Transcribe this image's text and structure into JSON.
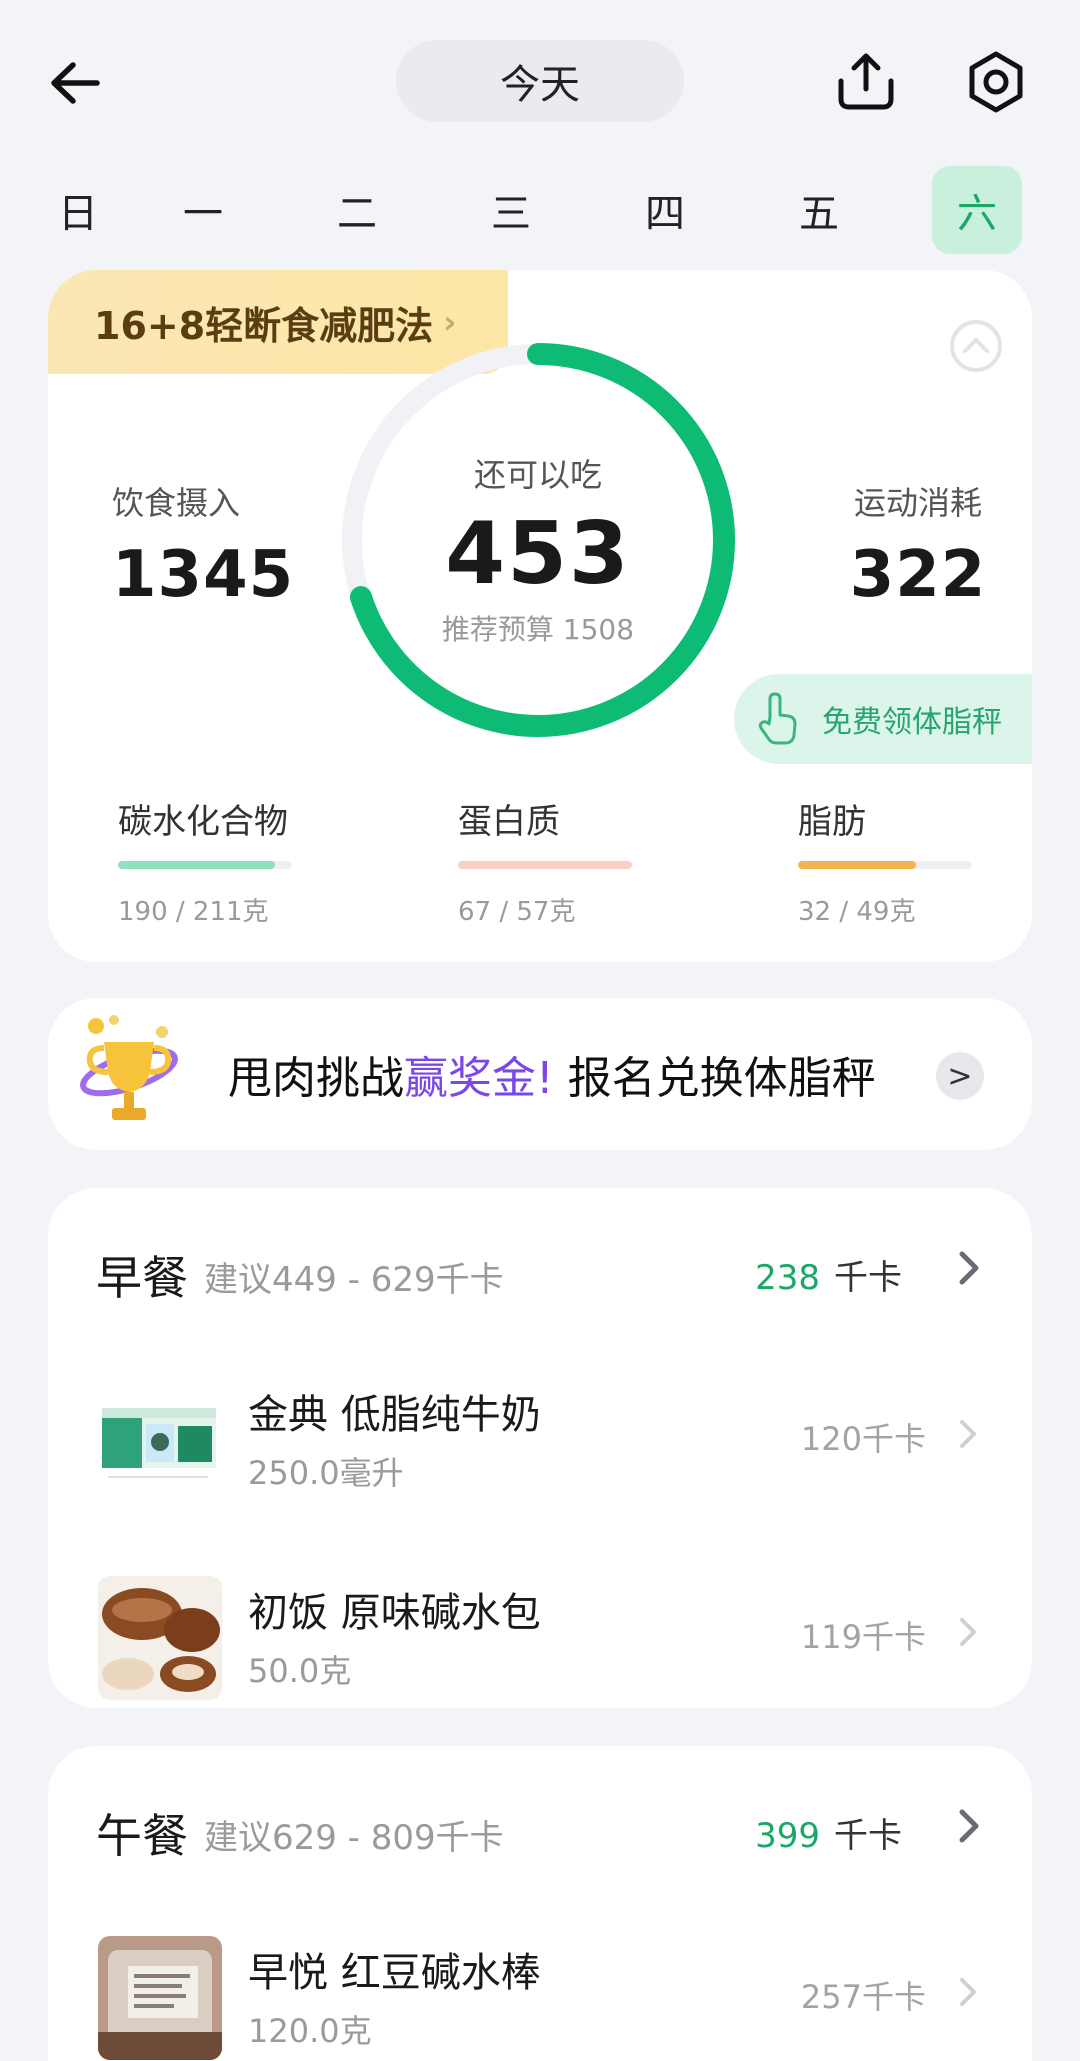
{
  "header": {
    "date_label": "今天",
    "back_icon": "arrow-left-icon",
    "share_icon": "upload-icon",
    "settings_icon": "hex-gear-icon"
  },
  "week": {
    "days": [
      "日",
      "一",
      "二",
      "三",
      "四",
      "五",
      "六"
    ],
    "active_index": 6
  },
  "summary": {
    "plan_banner": "16+8轻断食减肥法",
    "intake_label": "饮食摄入",
    "intake_value": "1345",
    "remain_label": "还可以吃",
    "remain_value": "453",
    "budget_label": "推荐预算 1508",
    "burn_label": "运动消耗",
    "burn_value": "322",
    "ring_progress": 0.7,
    "scale_promo": "免费领体脂秤",
    "macros": [
      {
        "name": "碳水化合物",
        "value": "190 / 211克",
        "fraction": 0.9,
        "color": "#8fe0bd"
      },
      {
        "name": "蛋白质",
        "value": "67 / 57克",
        "fraction": 1.0,
        "color": "#f8cfc9"
      },
      {
        "name": "脂肪",
        "value": "32 / 49克",
        "fraction": 0.68,
        "color": "#f1b450"
      }
    ],
    "accent": "#0dbb74"
  },
  "challenge": {
    "text_a": "甩肉挑战",
    "text_highlight": "赢奖金!",
    "text_b": "报名兑换体脂秤",
    "arrow": ">"
  },
  "meals": [
    {
      "title": "早餐",
      "suggest": "建议449 - 629千卡",
      "kcal": "238",
      "kcal_unit": "千卡",
      "foods": [
        {
          "name": "金典 低脂纯牛奶",
          "amount": "250.0毫升",
          "kcal": "120千卡"
        },
        {
          "name": "初饭 原味碱水包",
          "amount": "50.0克",
          "kcal": "119千卡"
        }
      ]
    },
    {
      "title": "午餐",
      "suggest": "建议629 - 809千卡",
      "kcal": "399",
      "kcal_unit": "千卡",
      "foods": [
        {
          "name": "早悦 红豆碱水棒",
          "amount": "120.0克",
          "kcal": "257千卡"
        }
      ]
    }
  ]
}
